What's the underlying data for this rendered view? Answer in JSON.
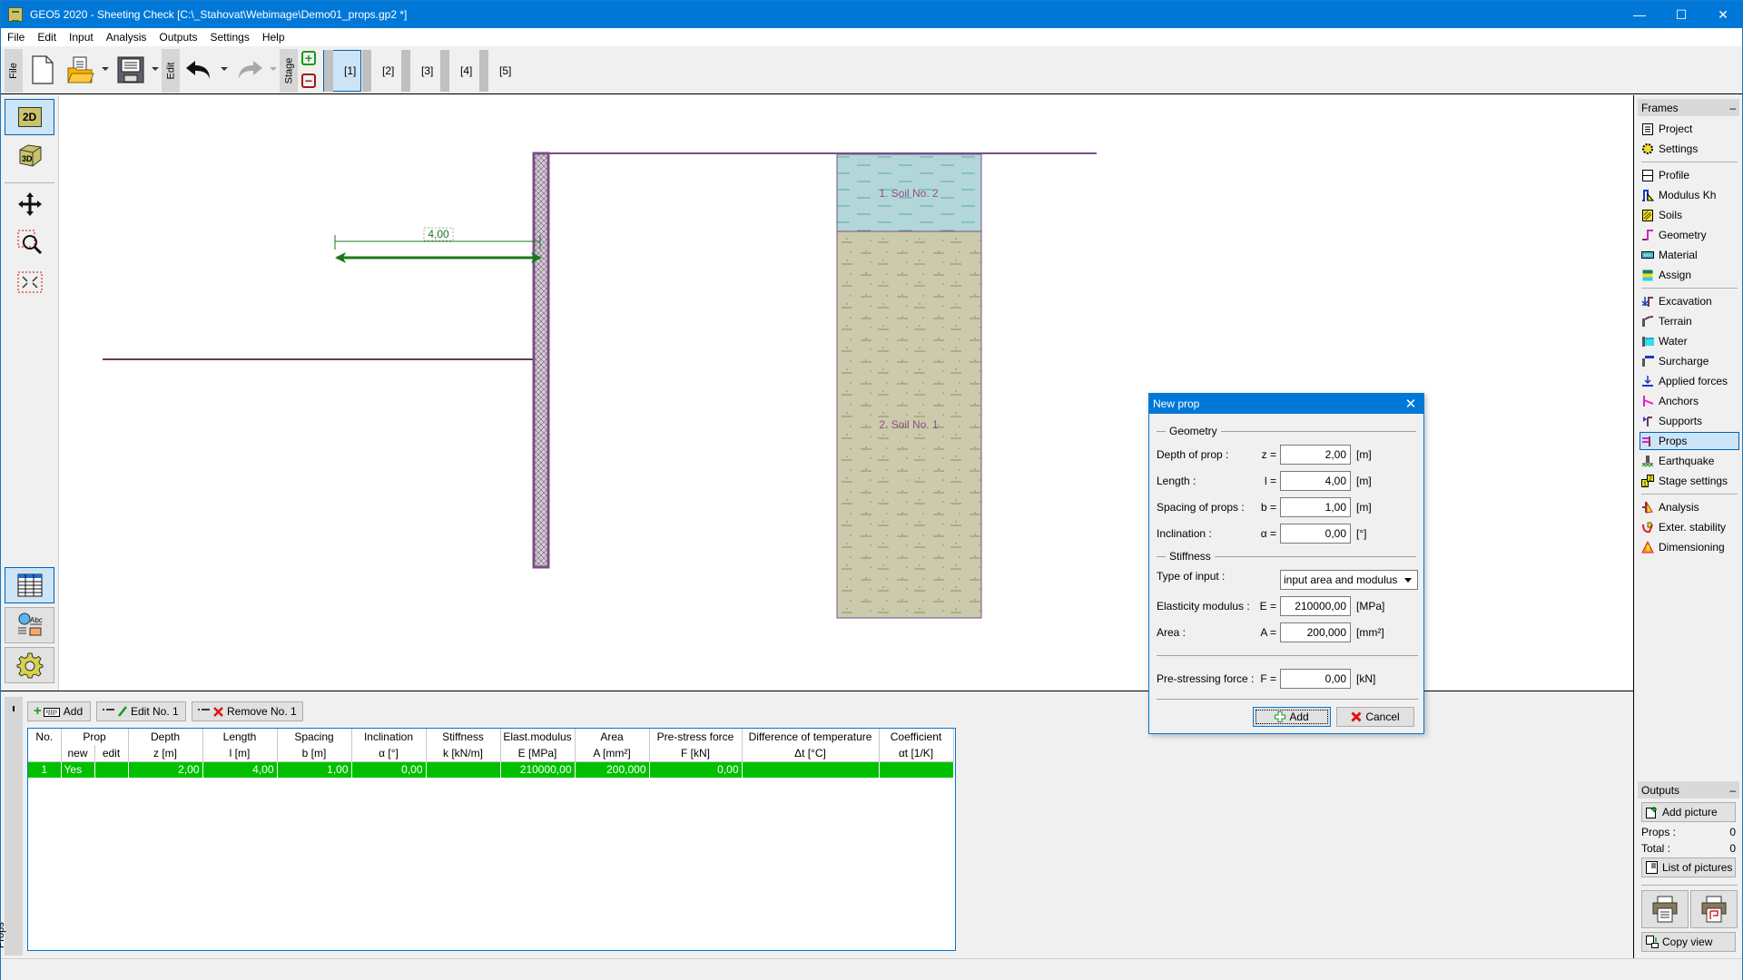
{
  "window": {
    "title": "GEO5 2020 - Sheeting Check [C:\\_Stahovat\\Webimage\\Demo01_props.gp2 *]",
    "controls": {
      "minimize": "—",
      "maximize": "☐",
      "close": "✕"
    }
  },
  "menu": [
    "File",
    "Edit",
    "Input",
    "Analysis",
    "Outputs",
    "Settings",
    "Help"
  ],
  "toolbar": {
    "file_label": "File",
    "edit_label": "Edit",
    "stage_label": "Stage",
    "stages": [
      "[1]",
      "[2]",
      "[3]",
      "[4]",
      "[5]"
    ],
    "active_stage": 1
  },
  "left_tools": {
    "view2d": "2D",
    "view3d": "3D"
  },
  "canvas": {
    "dimension_label": "4,00",
    "soil_layers": [
      "1. Soil No. 2",
      "2. Soil No. 1"
    ],
    "colors": {
      "wall": "#7b4f86",
      "prop": "#1a7a1a",
      "soil2": "#b3d7d8",
      "soil1": "#cbcaac",
      "terrain": "#6b3c44"
    }
  },
  "frames_panel": {
    "title": "Frames",
    "collapse": "–",
    "groups": [
      [
        "Project",
        "Settings"
      ],
      [
        "Profile",
        "Modulus Kh",
        "Soils",
        "Geometry",
        "Material",
        "Assign"
      ],
      [
        "Excavation",
        "Terrain",
        "Water",
        "Surcharge",
        "Applied forces",
        "Anchors",
        "Supports",
        "Props",
        "Earthquake",
        "Stage settings"
      ],
      [
        "Analysis",
        "Exter. stability",
        "Dimensioning"
      ]
    ],
    "active": "Props"
  },
  "outputs_panel": {
    "title": "Outputs",
    "collapse": "–",
    "add_picture": "Add picture",
    "props_label": "Props :",
    "props_count": "0",
    "total_label": "Total :",
    "total_count": "0",
    "list_pictures": "List of pictures",
    "copy_view": "Copy view"
  },
  "bottom_panel": {
    "tab_label": "Props",
    "buttons": {
      "add": "Add",
      "edit": "Edit No. 1",
      "remove": "Remove No. 1"
    },
    "table": {
      "header_top": [
        "No.",
        "Prop",
        "Depth",
        "Length",
        "Spacing",
        "Inclination",
        "Stiffness",
        "Elast.modulus",
        "Area",
        "Pre-stress force",
        "Difference of temperature",
        "Coefficient"
      ],
      "header_bottom": [
        "",
        "new",
        "edit",
        "z [m]",
        "l [m]",
        "b [m]",
        "α  [°]",
        "k [kN/m]",
        "E [MPa]",
        "A [mm²]",
        "F [kN]",
        "Δt [°C]",
        "αt [1/K]"
      ],
      "rows": [
        [
          "1",
          "Yes",
          "",
          "2,00",
          "4,00",
          "1,00",
          "0,00",
          "",
          "210000,00",
          "200,000",
          "0,00",
          "",
          ""
        ]
      ]
    }
  },
  "dialog": {
    "title": "New prop",
    "close": "✕",
    "geometry_label": "Geometry",
    "stiffness_label": "Stiffness",
    "fields": {
      "depth": {
        "label": "Depth of prop :",
        "symbol": "z =",
        "value": "2,00",
        "unit": "[m]"
      },
      "length": {
        "label": "Length :",
        "symbol": "l =",
        "value": "4,00",
        "unit": "[m]"
      },
      "spacing": {
        "label": "Spacing of props :",
        "symbol": "b =",
        "value": "1,00",
        "unit": "[m]"
      },
      "inclination": {
        "label": "Inclination :",
        "symbol": "α  =",
        "value": "0,00",
        "unit": "[°]"
      },
      "type_of_input": {
        "label": "Type of input :",
        "value": "input area and modulus"
      },
      "elasticity": {
        "label": "Elasticity modulus :",
        "symbol": "E  =",
        "value": "210000,00",
        "unit": "[MPa]"
      },
      "area": {
        "label": "Area :",
        "symbol": "A  =",
        "value": "200,000",
        "unit": "[mm²]"
      },
      "prestress": {
        "label": "Pre-stressing force :",
        "symbol": "F  =",
        "value": "0,00",
        "unit": "[kN]"
      }
    },
    "add_button": "Add",
    "cancel_button": "Cancel"
  }
}
